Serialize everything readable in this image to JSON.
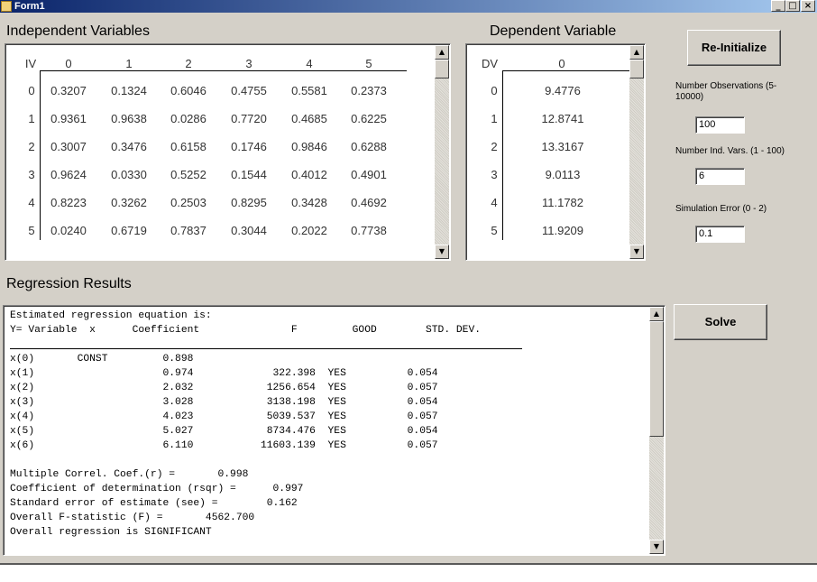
{
  "window": {
    "title": "Form1",
    "controls": [
      "_",
      "□",
      "×"
    ]
  },
  "independent": {
    "label": "Independent Variables",
    "corner_label": "IV",
    "columns": [
      "0",
      "1",
      "2",
      "3",
      "4",
      "5"
    ],
    "row_labels": [
      "0",
      "1",
      "2",
      "3",
      "4",
      "5"
    ],
    "rows": [
      [
        "0.3207",
        "0.1324",
        "0.6046",
        "0.4755",
        "0.5581",
        "0.2373"
      ],
      [
        "0.9361",
        "0.9638",
        "0.0286",
        "0.7720",
        "0.4685",
        "0.6225"
      ],
      [
        "0.3007",
        "0.3476",
        "0.6158",
        "0.1746",
        "0.9846",
        "0.6288"
      ],
      [
        "0.9624",
        "0.0330",
        "0.5252",
        "0.1544",
        "0.4012",
        "0.4901"
      ],
      [
        "0.8223",
        "0.3262",
        "0.2503",
        "0.8295",
        "0.3428",
        "0.4692"
      ],
      [
        "0.0240",
        "0.6719",
        "0.7837",
        "0.3044",
        "0.2022",
        "0.7738"
      ]
    ]
  },
  "dependent": {
    "label": "Dependent Variable",
    "corner_label": "DV",
    "column": "0",
    "row_labels": [
      "0",
      "1",
      "2",
      "3",
      "4",
      "5"
    ],
    "values": [
      "9.4776",
      "12.8741",
      "13.3167",
      "9.0113",
      "11.1782",
      "11.9209"
    ]
  },
  "reinitialize_button": "Re-Initialize",
  "fields": {
    "num_obs_label": "Number Observations (5-10000)",
    "num_obs_value": "100",
    "num_vars_label": "Number Ind. Vars. (1 - 100)",
    "num_vars_value": "6",
    "sim_error_label": "Simulation Error (0 - 2)",
    "sim_error_value": "0.1"
  },
  "regression": {
    "label": "Regression Results",
    "lines": [
      "Estimated regression equation is:",
      "Y= Variable  x      Coefficient               F         GOOD        STD. DEV.",
      "",
      "x(0)       CONST         0.898",
      "x(1)                     0.974             322.398  YES          0.054",
      "x(2)                     2.032            1256.654  YES          0.057",
      "x(3)                     3.028            3138.198  YES          0.054",
      "x(4)                     4.023            5039.537  YES          0.057",
      "x(5)                     5.027            8734.476  YES          0.054",
      "x(6)                     6.110           11603.139  YES          0.057",
      "",
      "Multiple Correl. Coef.(r) =       0.998",
      "Coefficient of determination (rsqr) =      0.997",
      "Standard error of estimate (see) =        0.162",
      "Overall F-statistic (F) =       4562.700",
      "Overall regression is SIGNIFICANT"
    ]
  },
  "solve_button": "Solve",
  "scroll_arrows": {
    "up": "▲",
    "down": "▼"
  }
}
